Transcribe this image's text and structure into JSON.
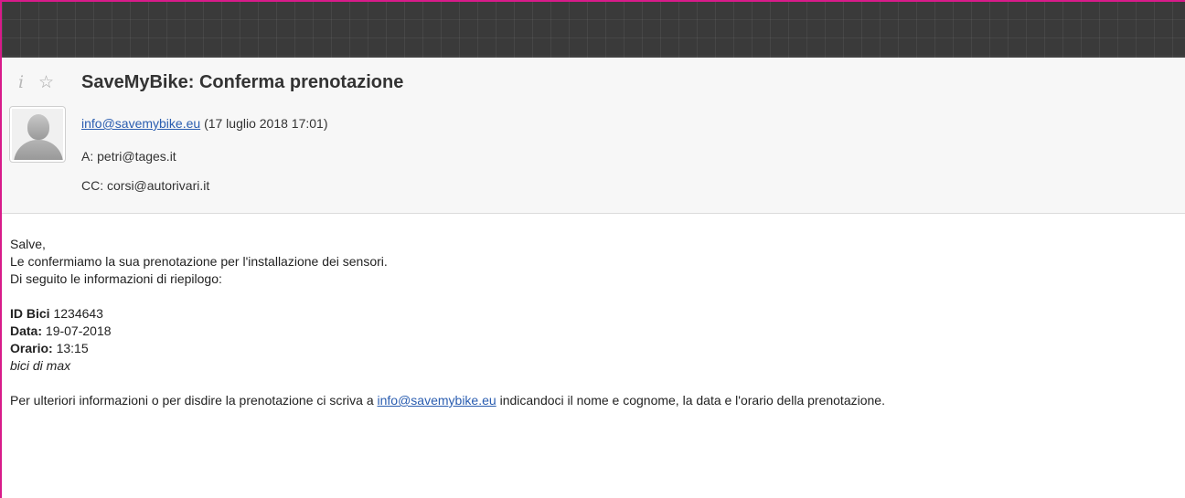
{
  "message": {
    "subject": "SaveMyBike: Conferma prenotazione",
    "from_email": "info@savemybike.eu",
    "date": "(17 luglio 2018 17:01)",
    "to": "A: petri@tages.it",
    "cc": "CC: corsi@autorivari.it"
  },
  "icons": {
    "info": "i",
    "star": "☆"
  },
  "body": {
    "greeting": "Salve,",
    "line1": "Le confermiamo la sua prenotazione per l'installazione dei sensori.",
    "line2": "Di seguito le informazioni di riepilogo:",
    "id_label": "ID Bici",
    "id_value": " 1234643",
    "data_label": "Data:",
    "data_value": " 19-07-2018",
    "orario_label": "Orario:",
    "orario_value": " 13:15",
    "note": "bici di max",
    "footer_before": "Per ulteriori informazioni o per disdire la prenotazione ci scriva a ",
    "footer_link": "info@savemybike.eu",
    "footer_after": " indicandoci il nome e cognome, la data e l'orario della prenotazione."
  },
  "colors": {
    "accent_border": "#d81b8a",
    "link": "#2a5db0",
    "topbar": "#3a3a3a"
  }
}
